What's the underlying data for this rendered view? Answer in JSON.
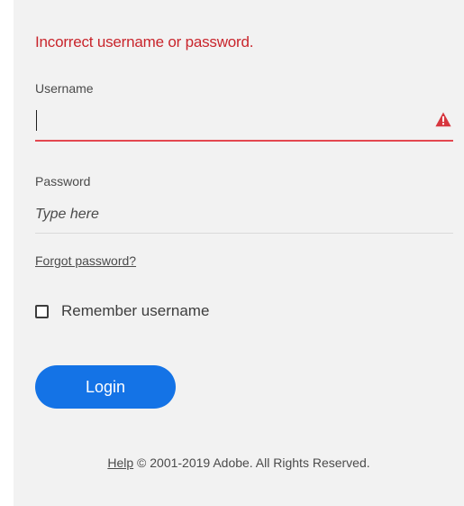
{
  "error": {
    "message": "Incorrect username or password.",
    "color": "#c9252c"
  },
  "username": {
    "label": "Username",
    "value": "",
    "icon": "alert-icon",
    "error_underline_color": "#e34850"
  },
  "password": {
    "label": "Password",
    "placeholder": "Type here",
    "value": ""
  },
  "links": {
    "forgot_password": "Forgot password?"
  },
  "remember": {
    "label": "Remember username",
    "checked": false
  },
  "login": {
    "label": "Login",
    "color": "#1473e6"
  },
  "footer": {
    "help_label": "Help",
    "copyright": "© 2001-2019 Adobe. All Rights Reserved."
  }
}
